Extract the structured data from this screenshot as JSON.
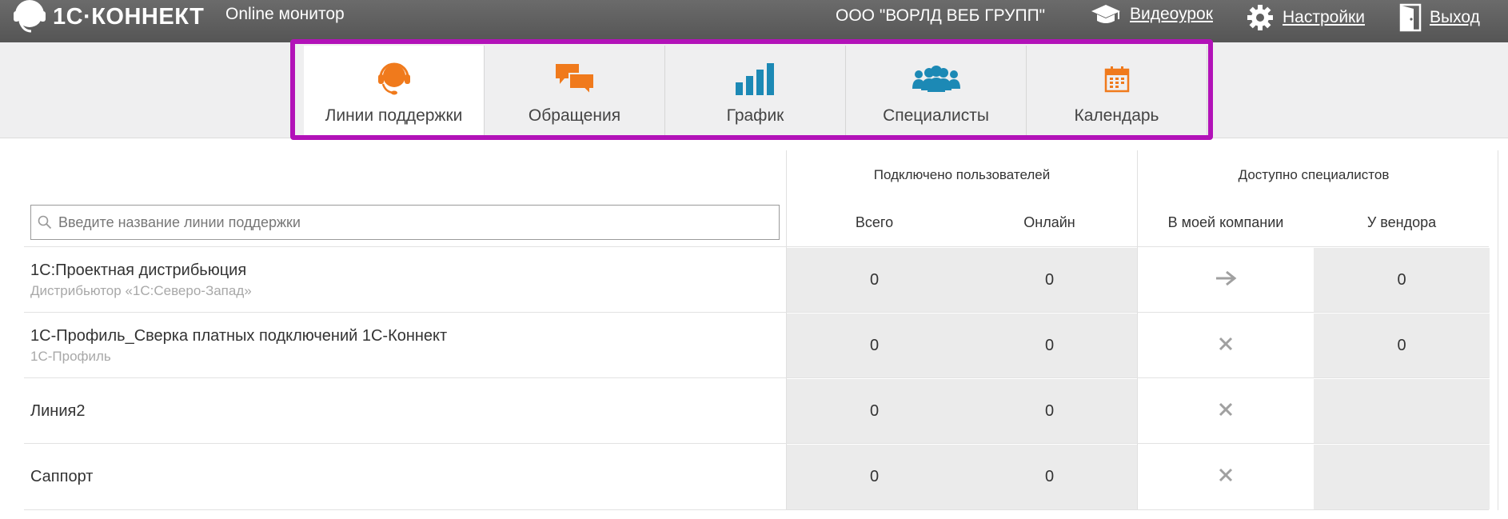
{
  "header": {
    "logo_text": "1С·КОННЕКТ",
    "app_title": "Online монитор",
    "org_name": "ООО \"ВОРЛД ВЕБ ГРУПП\"",
    "links": {
      "video": "Видеоурок",
      "settings": "Настройки",
      "exit": "Выход"
    }
  },
  "tabs": [
    {
      "label": "Линии поддержки",
      "icon": "headset-icon",
      "active": true
    },
    {
      "label": "Обращения",
      "icon": "chat-bubbles-icon",
      "active": false
    },
    {
      "label": "График",
      "icon": "bar-chart-icon",
      "active": false
    },
    {
      "label": "Специалисты",
      "icon": "people-icon",
      "active": false
    },
    {
      "label": "Календарь",
      "icon": "calendar-icon",
      "active": false
    }
  ],
  "colors": {
    "accent_orange": "#f07a1c",
    "accent_blue": "#1c89b5",
    "highlight_frame": "#b212b8"
  },
  "table": {
    "search_placeholder": "Введите название линии поддержки",
    "group_headers": {
      "connected": "Подключено пользователей",
      "available": "Доступно специалистов"
    },
    "sub_headers": {
      "total": "Всего",
      "online": "Онлайн",
      "my_company": "В моей компании",
      "vendor": "У вендора"
    },
    "rows": [
      {
        "name": "1С:Проектная дистрибьюция",
        "sub": "Дистрибьютор «1С:Северо-Запад»",
        "total": "0",
        "online": "0",
        "my_company": "arrow",
        "vendor": "0"
      },
      {
        "name": "1С-Профиль_Сверка платных подключений 1С-Коннект",
        "sub": "1С-Профиль",
        "total": "0",
        "online": "0",
        "my_company": "cross",
        "vendor": "0"
      },
      {
        "name": "Линия2",
        "sub": "",
        "total": "0",
        "online": "0",
        "my_company": "cross",
        "vendor": ""
      },
      {
        "name": "Саппорт",
        "sub": "",
        "total": "0",
        "online": "0",
        "my_company": "cross",
        "vendor": ""
      }
    ]
  }
}
